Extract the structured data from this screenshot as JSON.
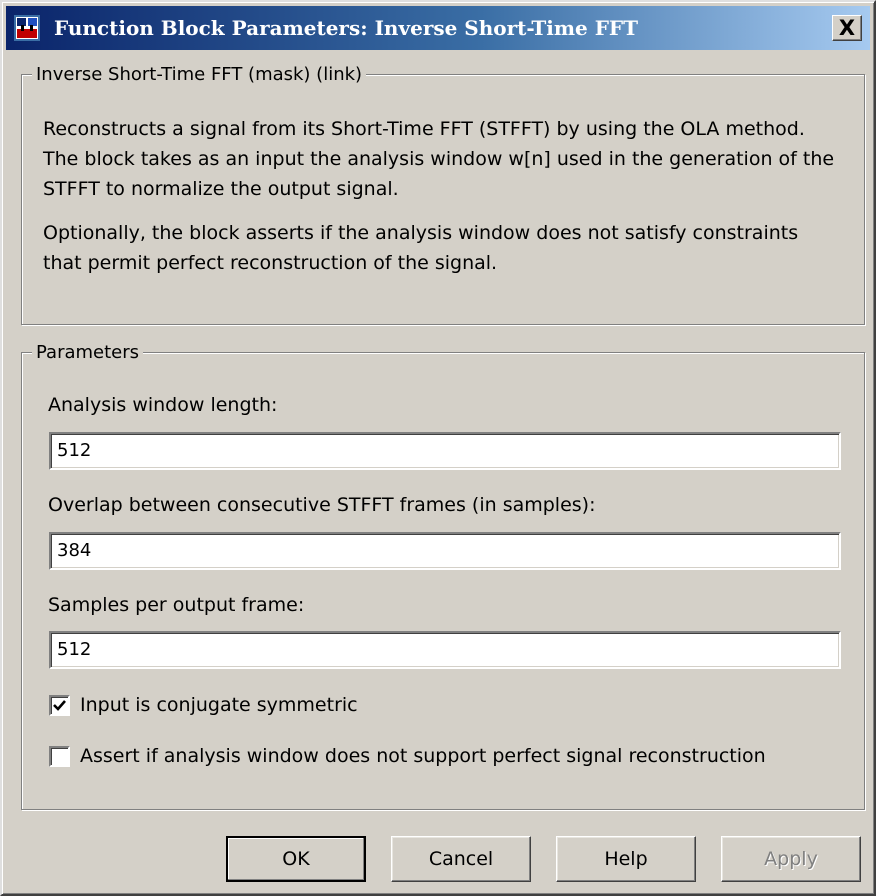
{
  "window": {
    "title": "Function Block Parameters: Inverse Short-Time FFT",
    "close_label": "X"
  },
  "description_group": {
    "legend": "Inverse Short-Time FFT (mask) (link)",
    "lines": [
      "Reconstructs a signal from its Short-Time FFT (STFFT) by using the OLA method.",
      "The block takes as an input the analysis window w[n] used in the generation of the",
      "STFFT to normalize the output signal.",
      "Optionally, the block asserts if the analysis window does not satisfy constraints",
      "that permit perfect reconstruction of the signal."
    ]
  },
  "parameters_group": {
    "legend": "Parameters",
    "fields": [
      {
        "label": "Analysis window length:",
        "value": "512"
      },
      {
        "label": "Overlap between consecutive STFFT frames (in samples):",
        "value": "384"
      },
      {
        "label": "Samples per output frame:",
        "value": "512"
      }
    ],
    "checkboxes": [
      {
        "label": "Input is conjugate symmetric",
        "checked": true
      },
      {
        "label": "Assert if analysis window does not support perfect signal reconstruction",
        "checked": false
      }
    ]
  },
  "buttons": {
    "ok": "OK",
    "cancel": "Cancel",
    "help": "Help",
    "apply": "Apply",
    "apply_enabled": false
  },
  "icons": {
    "title": "simulink-block-icon",
    "check": "checkmark-icon"
  },
  "colors": {
    "titlebar_start": "#0a246a",
    "titlebar_end": "#a6caf0",
    "dialog_face": "#d4d0c8"
  }
}
